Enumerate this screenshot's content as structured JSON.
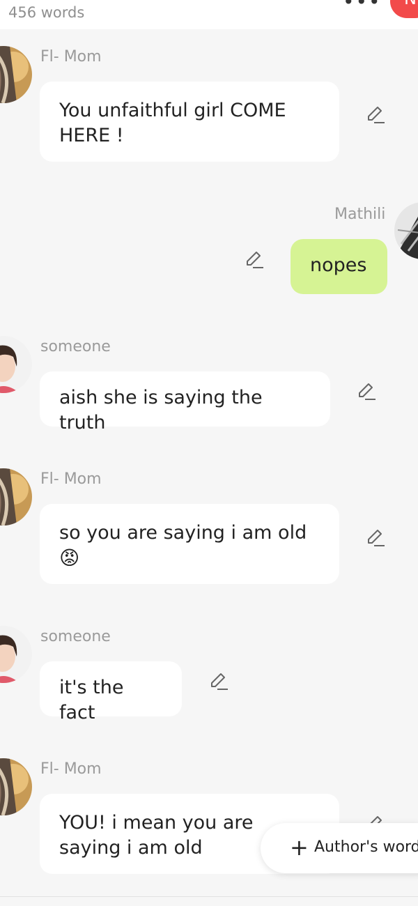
{
  "header": {
    "word_count": "456 words",
    "more_icon": "more-dots-icon",
    "red_pill_text": "N"
  },
  "messages": [
    {
      "sender": "Fl- Mom",
      "text": "You unfaithful girl COME HERE !",
      "side": "left",
      "avatar": "anime-girl-avatar"
    },
    {
      "sender": "Mathili",
      "text": "nopes",
      "side": "right",
      "avatar": "building-photo-avatar"
    },
    {
      "sender": "someone",
      "text": "aish she is saying the truth",
      "side": "left",
      "avatar": "anime-boy-avatar"
    },
    {
      "sender": "Fl- Mom",
      "text": "so you are saying i am old",
      "emoji": "😡",
      "side": "left",
      "avatar": "anime-girl-avatar"
    },
    {
      "sender": "someone",
      "text": "it's the fact",
      "side": "left",
      "avatar": "anime-boy-avatar"
    },
    {
      "sender": "Fl- Mom",
      "text": "YOU! i mean you are saying i am old",
      "side": "left",
      "avatar": "anime-girl-avatar"
    }
  ],
  "authors_words": {
    "plus": "+",
    "label": "Author's words"
  },
  "colors": {
    "background": "#f6f6f6",
    "bubble_other": "#ffffff",
    "bubble_me": "#d6f394",
    "accent_red": "#f24a4a",
    "name_gray": "#9a9a9a"
  }
}
